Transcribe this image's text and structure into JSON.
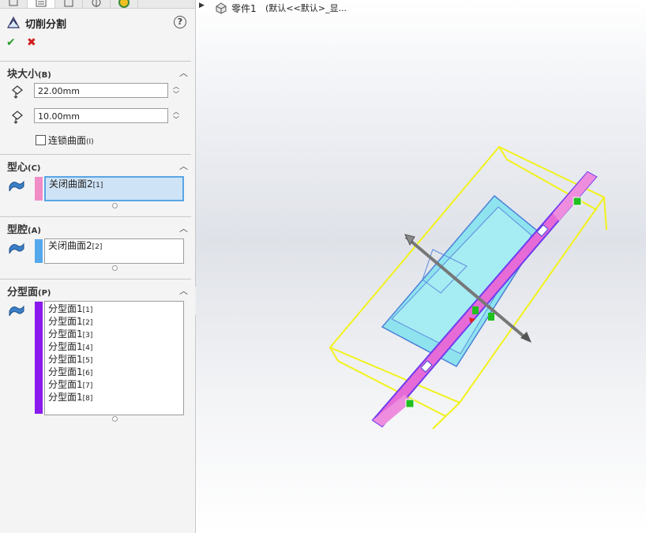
{
  "feature": {
    "title": "切削分割",
    "help_icon": "help-icon",
    "ok_icon": "✔",
    "cancel_icon": "✖"
  },
  "block_size": {
    "title": "块大小",
    "shortcut": "(B)",
    "depth_value": "22.00mm",
    "height_value": "10.00mm",
    "interlock_label": "连锁曲面",
    "interlock_shortcut": "(I)",
    "interlock_checked": false
  },
  "core": {
    "title": "型心",
    "shortcut": "(C)",
    "color": "#f08cc6",
    "item_main": "关闭曲面2",
    "item_sub": "[1]"
  },
  "cavity": {
    "title": "型腔",
    "shortcut": "(A)",
    "color": "#56a8ec",
    "item_main": "关闭曲面2",
    "item_sub": "[2]"
  },
  "parting": {
    "title": "分型面",
    "shortcut": "(P)",
    "color": "#8b1aef",
    "items": [
      {
        "main": "分型面1",
        "sub": "[1]"
      },
      {
        "main": "分型面1",
        "sub": "[2]"
      },
      {
        "main": "分型面1",
        "sub": "[3]"
      },
      {
        "main": "分型面1",
        "sub": "[4]"
      },
      {
        "main": "分型面1",
        "sub": "[5]"
      },
      {
        "main": "分型面1",
        "sub": "[6]"
      },
      {
        "main": "分型面1",
        "sub": "[7]"
      },
      {
        "main": "分型面1",
        "sub": "[8]"
      }
    ]
  },
  "tree": {
    "part_name": "零件1",
    "config": "(默认<<默认>_显..."
  },
  "colors": {
    "block_outline": "#f2f21a",
    "parting_surface": "#e66bd6",
    "part_body": "#8fe3ef"
  }
}
